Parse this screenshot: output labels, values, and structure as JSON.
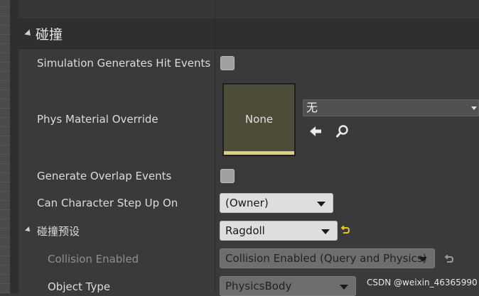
{
  "section": {
    "title": "碰撞"
  },
  "rows": {
    "sim_hit_events": {
      "label": "Simulation Generates Hit Events",
      "checked": false
    },
    "phys_material": {
      "label": "Phys Material Override",
      "thumbnail_text": "None",
      "asset_value": "无"
    },
    "overlap_events": {
      "label": "Generate Overlap Events",
      "checked": false
    },
    "step_up": {
      "label": "Can Character Step Up On",
      "value": "(Owner)"
    },
    "collision_preset": {
      "label": "碰撞预设",
      "value": "Ragdoll"
    },
    "collision_enabled": {
      "label": "Collision Enabled",
      "value": "Collision Enabled (Query and Physics)"
    },
    "object_type": {
      "label": "Object Type",
      "value": "PhysicsBody"
    }
  },
  "watermark": "CSDN @weixin_46365990",
  "colors": {
    "panel_bg": "#3a3a3a",
    "header_bg": "#2f2f2f",
    "thumbnail_bg": "#4d4c39",
    "reset_arrow": "#e6c619"
  },
  "icons": [
    "expand-triangle-icon",
    "use-selected-arrow-icon",
    "browse-magnifier-icon",
    "reset-to-default-icon"
  ]
}
